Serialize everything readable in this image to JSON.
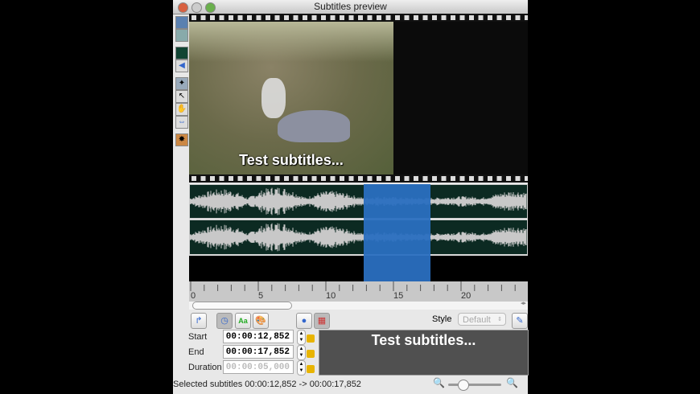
{
  "window": {
    "title": "Subtitles preview"
  },
  "video": {
    "subtitle": "Test subtitles..."
  },
  "ruler": {
    "ticks": [
      "0",
      "5",
      "10",
      "15",
      "20"
    ]
  },
  "toolbar": {
    "style_label": "Style",
    "style_value": "Default"
  },
  "timing": {
    "start_label": "Start",
    "start_value": "00:00:12,852",
    "end_label": "End",
    "end_value": "00:00:17,852",
    "duration_label": "Duration",
    "duration_value": "00:00:05,000"
  },
  "preview": {
    "text": "Test subtitles..."
  },
  "status": {
    "text": "Selected subtitles 00:00:12,852 -> 00:00:17,852"
  },
  "selection": {
    "start_s": 12.852,
    "end_s": 17.852
  },
  "colors": {
    "selection": "#2a6fc0",
    "wave_bg": "#0c2a22"
  }
}
